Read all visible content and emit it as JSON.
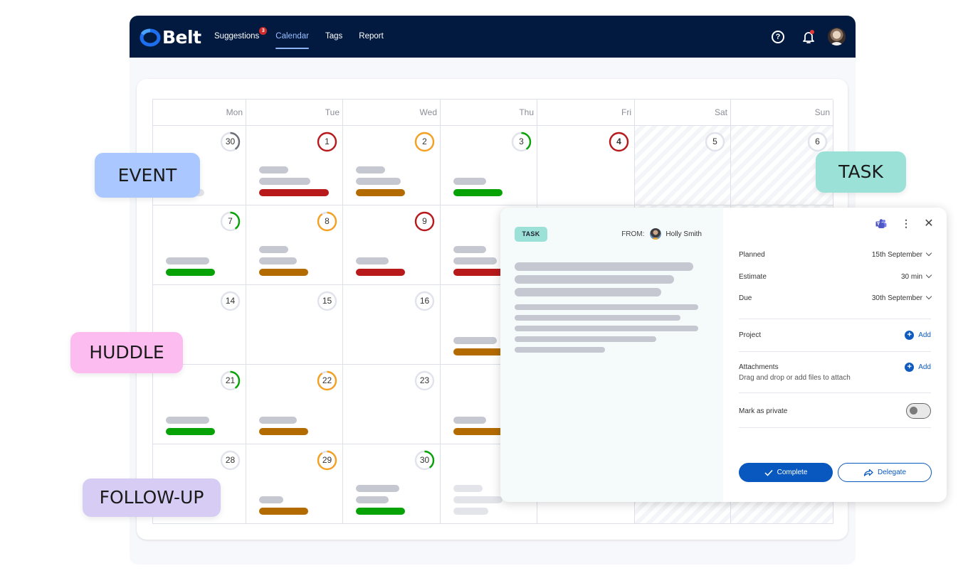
{
  "app": {
    "brand": "Belt",
    "nav": [
      {
        "label": "Suggestions",
        "badge": "3",
        "active": false
      },
      {
        "label": "Calendar",
        "active": true
      },
      {
        "label": "Tags",
        "active": false
      },
      {
        "label": "Report",
        "active": false
      }
    ],
    "icons": {
      "help": "help-icon",
      "notifications": "bell-icon",
      "profile": "avatar"
    }
  },
  "calendar": {
    "weekdays": [
      "Mon",
      "Tue",
      "Wed",
      "Thu",
      "Fri",
      "Sat",
      "Sun"
    ],
    "weeks": [
      [
        {
          "day": "30",
          "ring": "#6b6e78",
          "progress": 0.4,
          "bars": [
            "#e2e4ea:40"
          ]
        },
        {
          "day": "1",
          "ring": "#b8191b",
          "progress": 1,
          "bars": [
            "#c5c8d1:30",
            "#c5c8d1:53",
            "#b8191b:72"
          ]
        },
        {
          "day": "2",
          "ring": "#f5a020",
          "progress": 1,
          "bars": [
            "#c5c8d1:30",
            "#c5c8d1:46",
            "#b36b00:51"
          ]
        },
        {
          "day": "3",
          "ring": "#06a206",
          "progress": 0.4,
          "bars": [
            "#c5c8d1:34",
            "#06a206:51"
          ]
        },
        {
          "day": "4",
          "ring": "#b8191b",
          "progress": 1,
          "bold": true,
          "bars": []
        },
        {
          "day": "5",
          "ring": "#dfe1ea",
          "progress": 0,
          "weekend": true,
          "bars": []
        },
        {
          "day": "6",
          "ring": "#dfe1ea",
          "progress": 0,
          "weekend": true,
          "bars": []
        }
      ],
      [
        {
          "day": "7",
          "ring": "#06a206",
          "progress": 0.4,
          "bars": [
            "#c5c8d1:45",
            "#06a206:51"
          ]
        },
        {
          "day": "8",
          "ring": "#f5a020",
          "progress": 0.9,
          "bars": [
            "#c5c8d1:30",
            "#c5c8d1:39",
            "#b36b00:51"
          ]
        },
        {
          "day": "9",
          "ring": "#b8191b",
          "progress": 1,
          "bars": [
            "#c5c8d1:34",
            "#b8191b:51"
          ]
        },
        {
          "day": "",
          "ring": "",
          "progress": 0,
          "bars": [
            "#c5c8d1:34",
            "#c5c8d1:45",
            "#b8191b:60"
          ]
        },
        {
          "day": "",
          "ring": "",
          "progress": 0,
          "bars": []
        },
        {
          "day": "",
          "ring": "",
          "progress": 0,
          "weekend": true,
          "bars": []
        },
        {
          "day": "",
          "ring": "",
          "progress": 0,
          "weekend": true,
          "bars": []
        }
      ],
      [
        {
          "day": "14",
          "ring": "#dfe1ea",
          "progress": 0,
          "bars": []
        },
        {
          "day": "15",
          "ring": "#dfe1ea",
          "progress": 0,
          "bars": []
        },
        {
          "day": "16",
          "ring": "#dfe1ea",
          "progress": 0,
          "bars": []
        },
        {
          "day": "",
          "ring": "",
          "progress": 0,
          "bars": [
            "#c5c8d1:45",
            "#b36b00:60"
          ]
        },
        {
          "day": "",
          "ring": "",
          "progress": 0,
          "bars": []
        },
        {
          "day": "",
          "ring": "",
          "progress": 0,
          "weekend": true,
          "bars": []
        },
        {
          "day": "",
          "ring": "",
          "progress": 0,
          "weekend": true,
          "bars": []
        }
      ],
      [
        {
          "day": "21",
          "ring": "#06a206",
          "progress": 0.4,
          "bars": [
            "#c5c8d1:45",
            "#06a206:51"
          ]
        },
        {
          "day": "22",
          "ring": "#f5a020",
          "progress": 0.9,
          "bars": [
            "#c5c8d1:39",
            "#b36b00:51"
          ]
        },
        {
          "day": "23",
          "ring": "#dfe1ea",
          "progress": 0,
          "bars": []
        },
        {
          "day": "",
          "ring": "",
          "progress": 0,
          "bars": [
            "#c5c8d1:34",
            "#b36b00:60"
          ]
        },
        {
          "day": "",
          "ring": "",
          "progress": 0,
          "bars": []
        },
        {
          "day": "",
          "ring": "",
          "progress": 0,
          "weekend": true,
          "bars": []
        },
        {
          "day": "",
          "ring": "",
          "progress": 0,
          "weekend": true,
          "bars": []
        }
      ],
      [
        {
          "day": "28",
          "ring": "#dfe1ea",
          "progress": 0,
          "bars": []
        },
        {
          "day": "29",
          "ring": "#f5a020",
          "progress": 0.9,
          "bars": [
            "#c5c8d1:25",
            "#b36b00:51"
          ]
        },
        {
          "day": "30",
          "ring": "#06a206",
          "progress": 0.4,
          "bars": [
            "#c5c8d1:45",
            "#c5c8d1:34",
            "#06a206:51"
          ]
        },
        {
          "day": "",
          "ring": "",
          "progress": 0,
          "bars": [
            "#e2e4ea:30",
            "#e2e4ea:51",
            "#e2e4ea:36"
          ]
        },
        {
          "day": "",
          "ring": "",
          "progress": 0,
          "bars": []
        },
        {
          "day": "",
          "ring": "",
          "progress": 0,
          "weekend": true,
          "bars": []
        },
        {
          "day": "",
          "ring": "",
          "progress": 0,
          "weekend": true,
          "bars": []
        }
      ]
    ]
  },
  "labels": {
    "event": {
      "text": "EVENT",
      "color": "#aac8ff"
    },
    "task": {
      "text": "TASK",
      "color": "#9ce1d8"
    },
    "huddle": {
      "text": "HUDDLE",
      "color": "#fcbcf0"
    },
    "followup": {
      "text": "FOLLOW-UP",
      "color": "#d6ccf4"
    }
  },
  "task_panel": {
    "tag": "TASK",
    "from_label": "FROM:",
    "from_name": "Holly Smith",
    "fields": [
      {
        "label": "Planned",
        "value": "15th September"
      },
      {
        "label": "Estimate",
        "value": "30 min"
      },
      {
        "label": "Due",
        "value": "30th September"
      }
    ],
    "project_label": "Project",
    "project_add": "Add",
    "attachments_label": "Attachments",
    "attachments_add": "Add",
    "attachments_hint": "Drag and drop or add files to attach",
    "private_label": "Mark as private",
    "private_on": false,
    "complete_label": "Complete",
    "delegate_label": "Delegate"
  }
}
